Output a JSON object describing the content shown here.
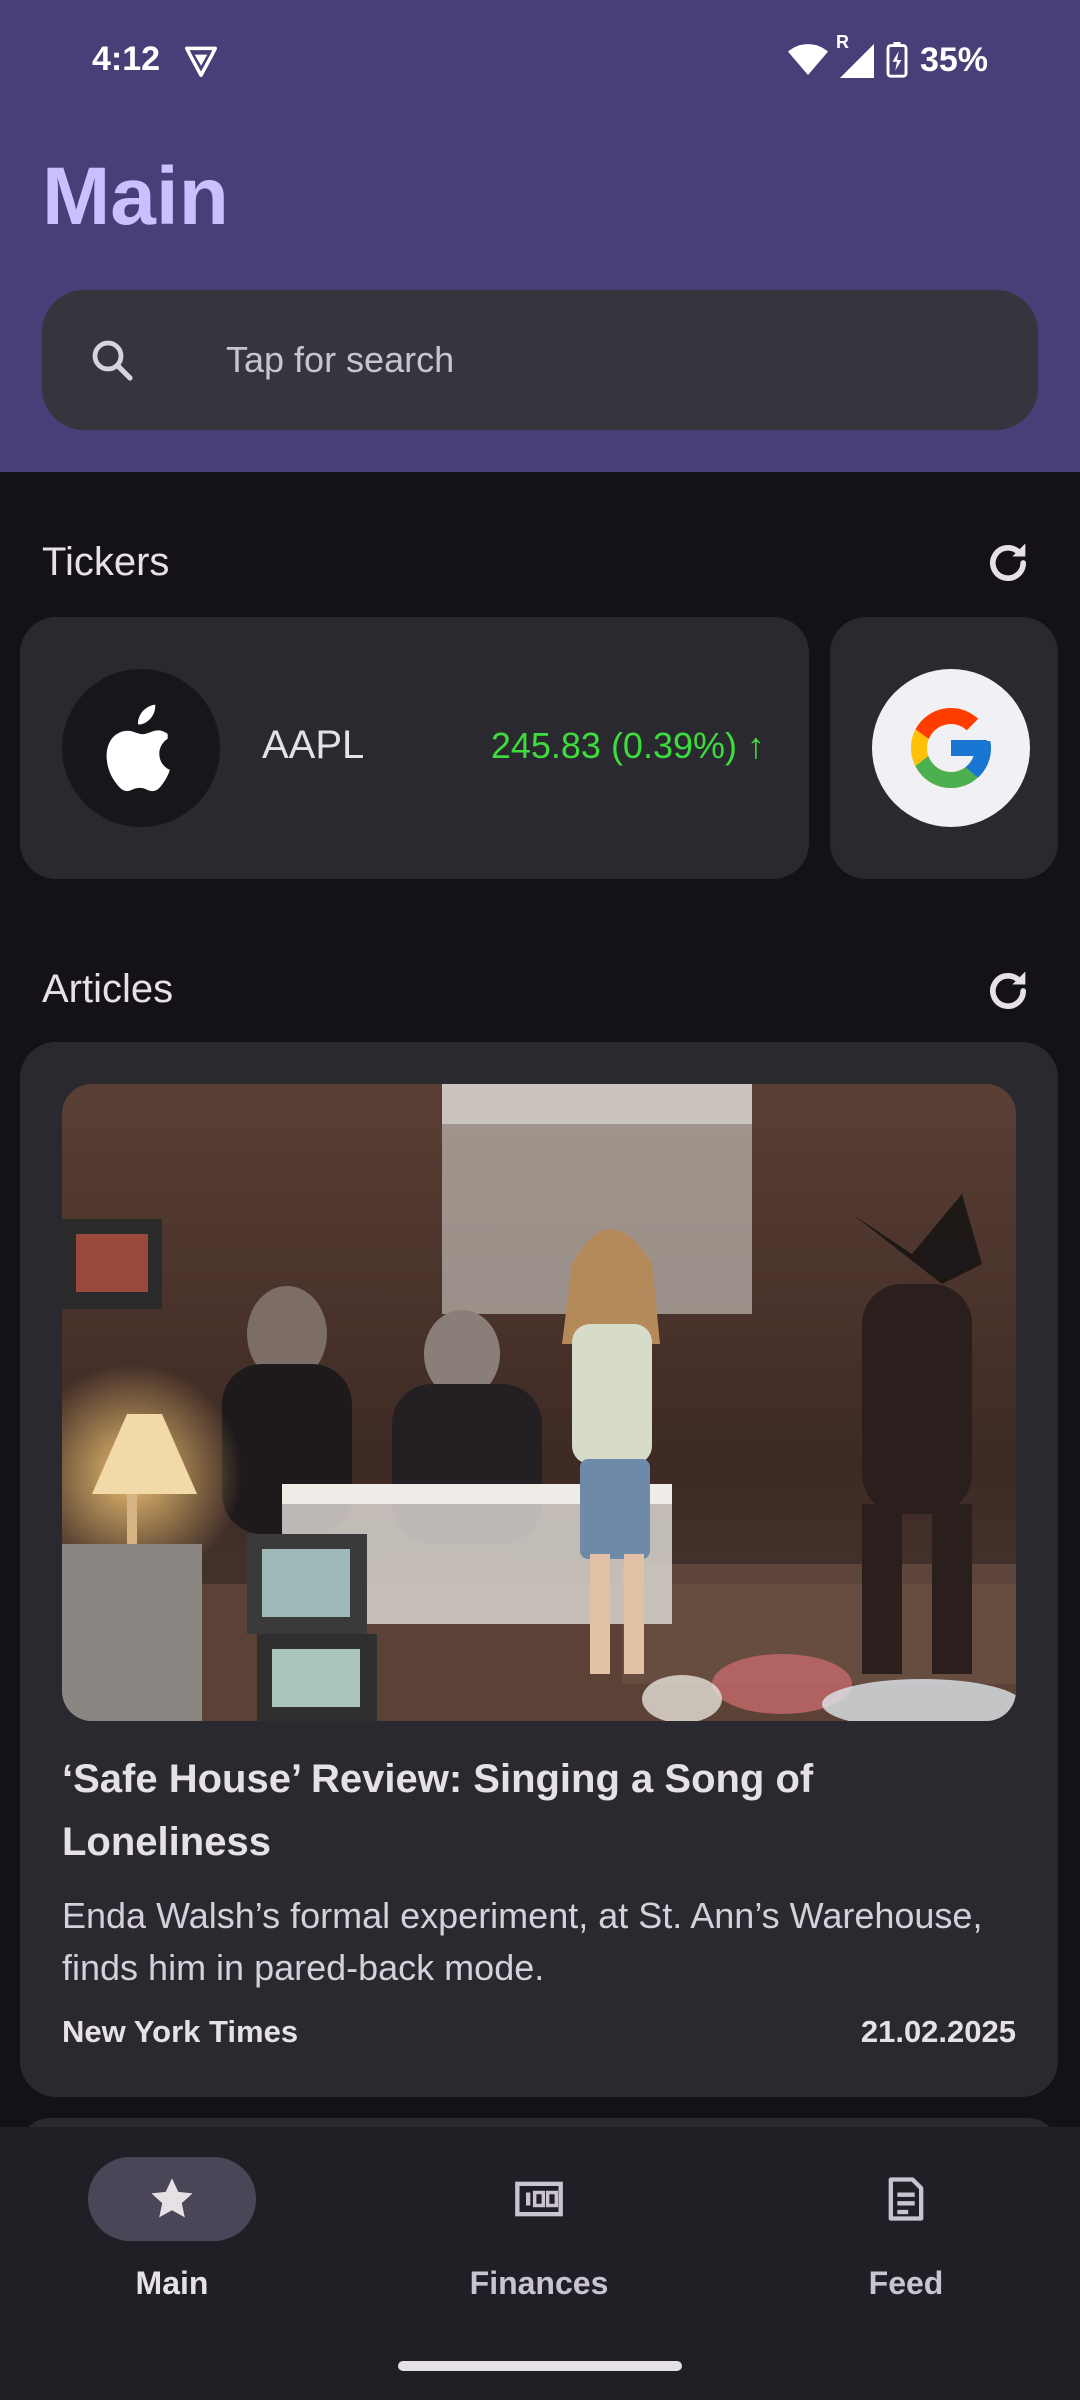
{
  "status_bar": {
    "time": "4:12",
    "battery": "35%",
    "roaming": "R"
  },
  "header": {
    "title": "Main"
  },
  "search": {
    "placeholder": "Tap for search"
  },
  "tickers": {
    "title": "Tickers",
    "items": [
      {
        "symbol": "AAPL",
        "price": "245.83 (0.39%) ↑",
        "logo": "apple-logo",
        "trend_color": "#3ddc3d"
      },
      {
        "logo": "google-logo"
      }
    ]
  },
  "articles": {
    "title": "Articles",
    "items": [
      {
        "title": "‘Safe House’ Review: Singing a Song of Loneliness",
        "description": "Enda Walsh’s formal experiment, at St. Ann’s Warehouse, finds him in pared-back mode.",
        "source": "New York Times",
        "date": "21.02.2025"
      }
    ]
  },
  "nav": {
    "items": [
      {
        "label": "Main",
        "icon": "star-icon",
        "active": true
      },
      {
        "label": "Finances",
        "icon": "banknote-icon",
        "active": false
      },
      {
        "label": "Feed",
        "icon": "article-icon",
        "active": false
      }
    ]
  },
  "colors": {
    "header_bg": "#483f78",
    "title": "#c8c0ff",
    "positive": "#3ddc3d"
  }
}
